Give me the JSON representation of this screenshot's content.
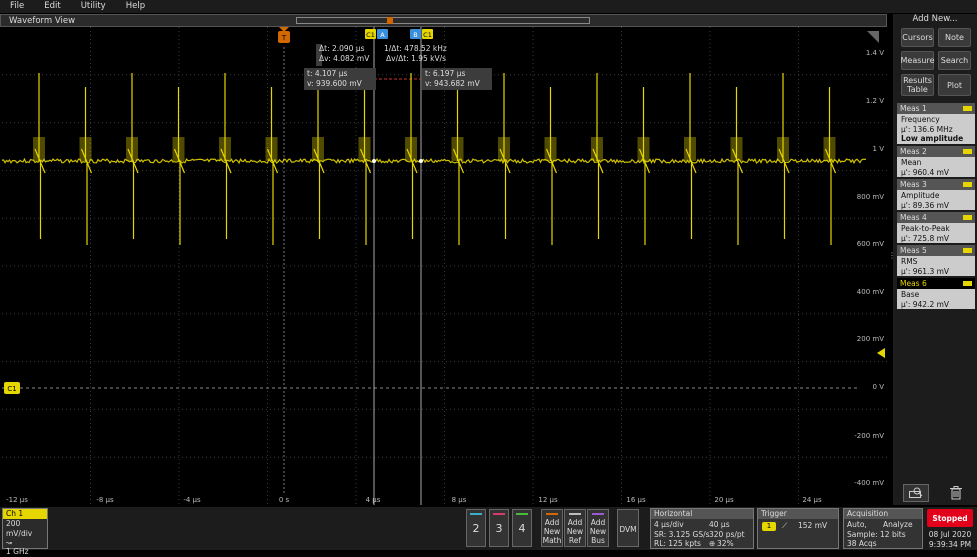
{
  "menu": [
    "File",
    "Edit",
    "Utility",
    "Help"
  ],
  "waveform_view_title": "Waveform View",
  "cursor_readouts": {
    "delta_t": "Δt: 2.090 µs",
    "delta_v": "Δv: 4.082 mV",
    "inv_delta_t": "1/Δt: 478.52 kHz",
    "dv_dt": "Δv/Δt: 1.95 kV/s",
    "a_t": "t: 4.107 µs",
    "a_v": "v: 939.600 mV",
    "b_t": "t: 6.197 µs",
    "b_v": "v: 943.682 mV"
  },
  "cursor_tags": {
    "a_ch": "C1",
    "a": "A",
    "b": "B",
    "b_ch": "C1"
  },
  "trigger_marker": "T",
  "ch1_marker": "C1",
  "x_ticks": [
    "-12 µs",
    "-8 µs",
    "-4 µs",
    "0 s",
    "4 µs",
    "8 µs",
    "12 µs",
    "16 µs",
    "20 µs",
    "24 µs"
  ],
  "y_ticks": [
    "1.4 V",
    "1.2 V",
    "1 V",
    "800 mV",
    "600 mV",
    "400 mV",
    "200 mV",
    "0 V",
    "-200 mV",
    "-400 mV"
  ],
  "right_panel": {
    "title": "Add New...",
    "buttons": [
      "Cursors",
      "Note",
      "Measure",
      "Search",
      "Results Table",
      "Plot"
    ],
    "measurements": [
      {
        "name": "Meas 1",
        "label": "Frequency",
        "value": "µ': 136.6 MHz",
        "note": "Low amplitude"
      },
      {
        "name": "Meas 2",
        "label": "Mean",
        "value": "µ': 960.4 mV"
      },
      {
        "name": "Meas 3",
        "label": "Amplitude",
        "value": "µ': 89.36 mV"
      },
      {
        "name": "Meas 4",
        "label": "Peak-to-Peak",
        "value": "µ': 725.8 mV"
      },
      {
        "name": "Meas 5",
        "label": "RMS",
        "value": "µ': 961.3 mV"
      },
      {
        "name": "Meas 6",
        "label": "Base",
        "value": "µ': 942.2 mV"
      }
    ]
  },
  "ch1": {
    "title": "Ch 1",
    "scale": "200 mV/div",
    "bandwidth": "1 GHz"
  },
  "channel_buttons": [
    "2",
    "3",
    "4"
  ],
  "new_buttons": [
    {
      "l1": "Add",
      "l2": "New",
      "l3": "Math"
    },
    {
      "l1": "Add",
      "l2": "New",
      "l3": "Ref"
    },
    {
      "l1": "Add",
      "l2": "New",
      "l3": "Bus"
    }
  ],
  "dvm_label": "DVM",
  "horizontal": {
    "title": "Horizontal",
    "scale": "4 µs/div",
    "position": "40 µs",
    "sr": "SR: 3.125 GS/s",
    "pt": "320 ps/pt",
    "rl": "RL: 125 kpts",
    "pct": "32%"
  },
  "trigger": {
    "title": "Trigger",
    "source": "1",
    "level": "152 mV"
  },
  "acquisition": {
    "title": "Acquisition",
    "mode": "Auto,",
    "analyze": "Analyze",
    "sample": "Sample: 12 bits",
    "acqs": "38 Acqs"
  },
  "run_state": "Stopped",
  "date": "08 Jul 2020",
  "time": "9:39:34 PM",
  "colors": {
    "ch1": "#e6d600",
    "trigger": "#d46800",
    "cursor_b": "#3a8fdc",
    "stopped": "#e2001a"
  }
}
